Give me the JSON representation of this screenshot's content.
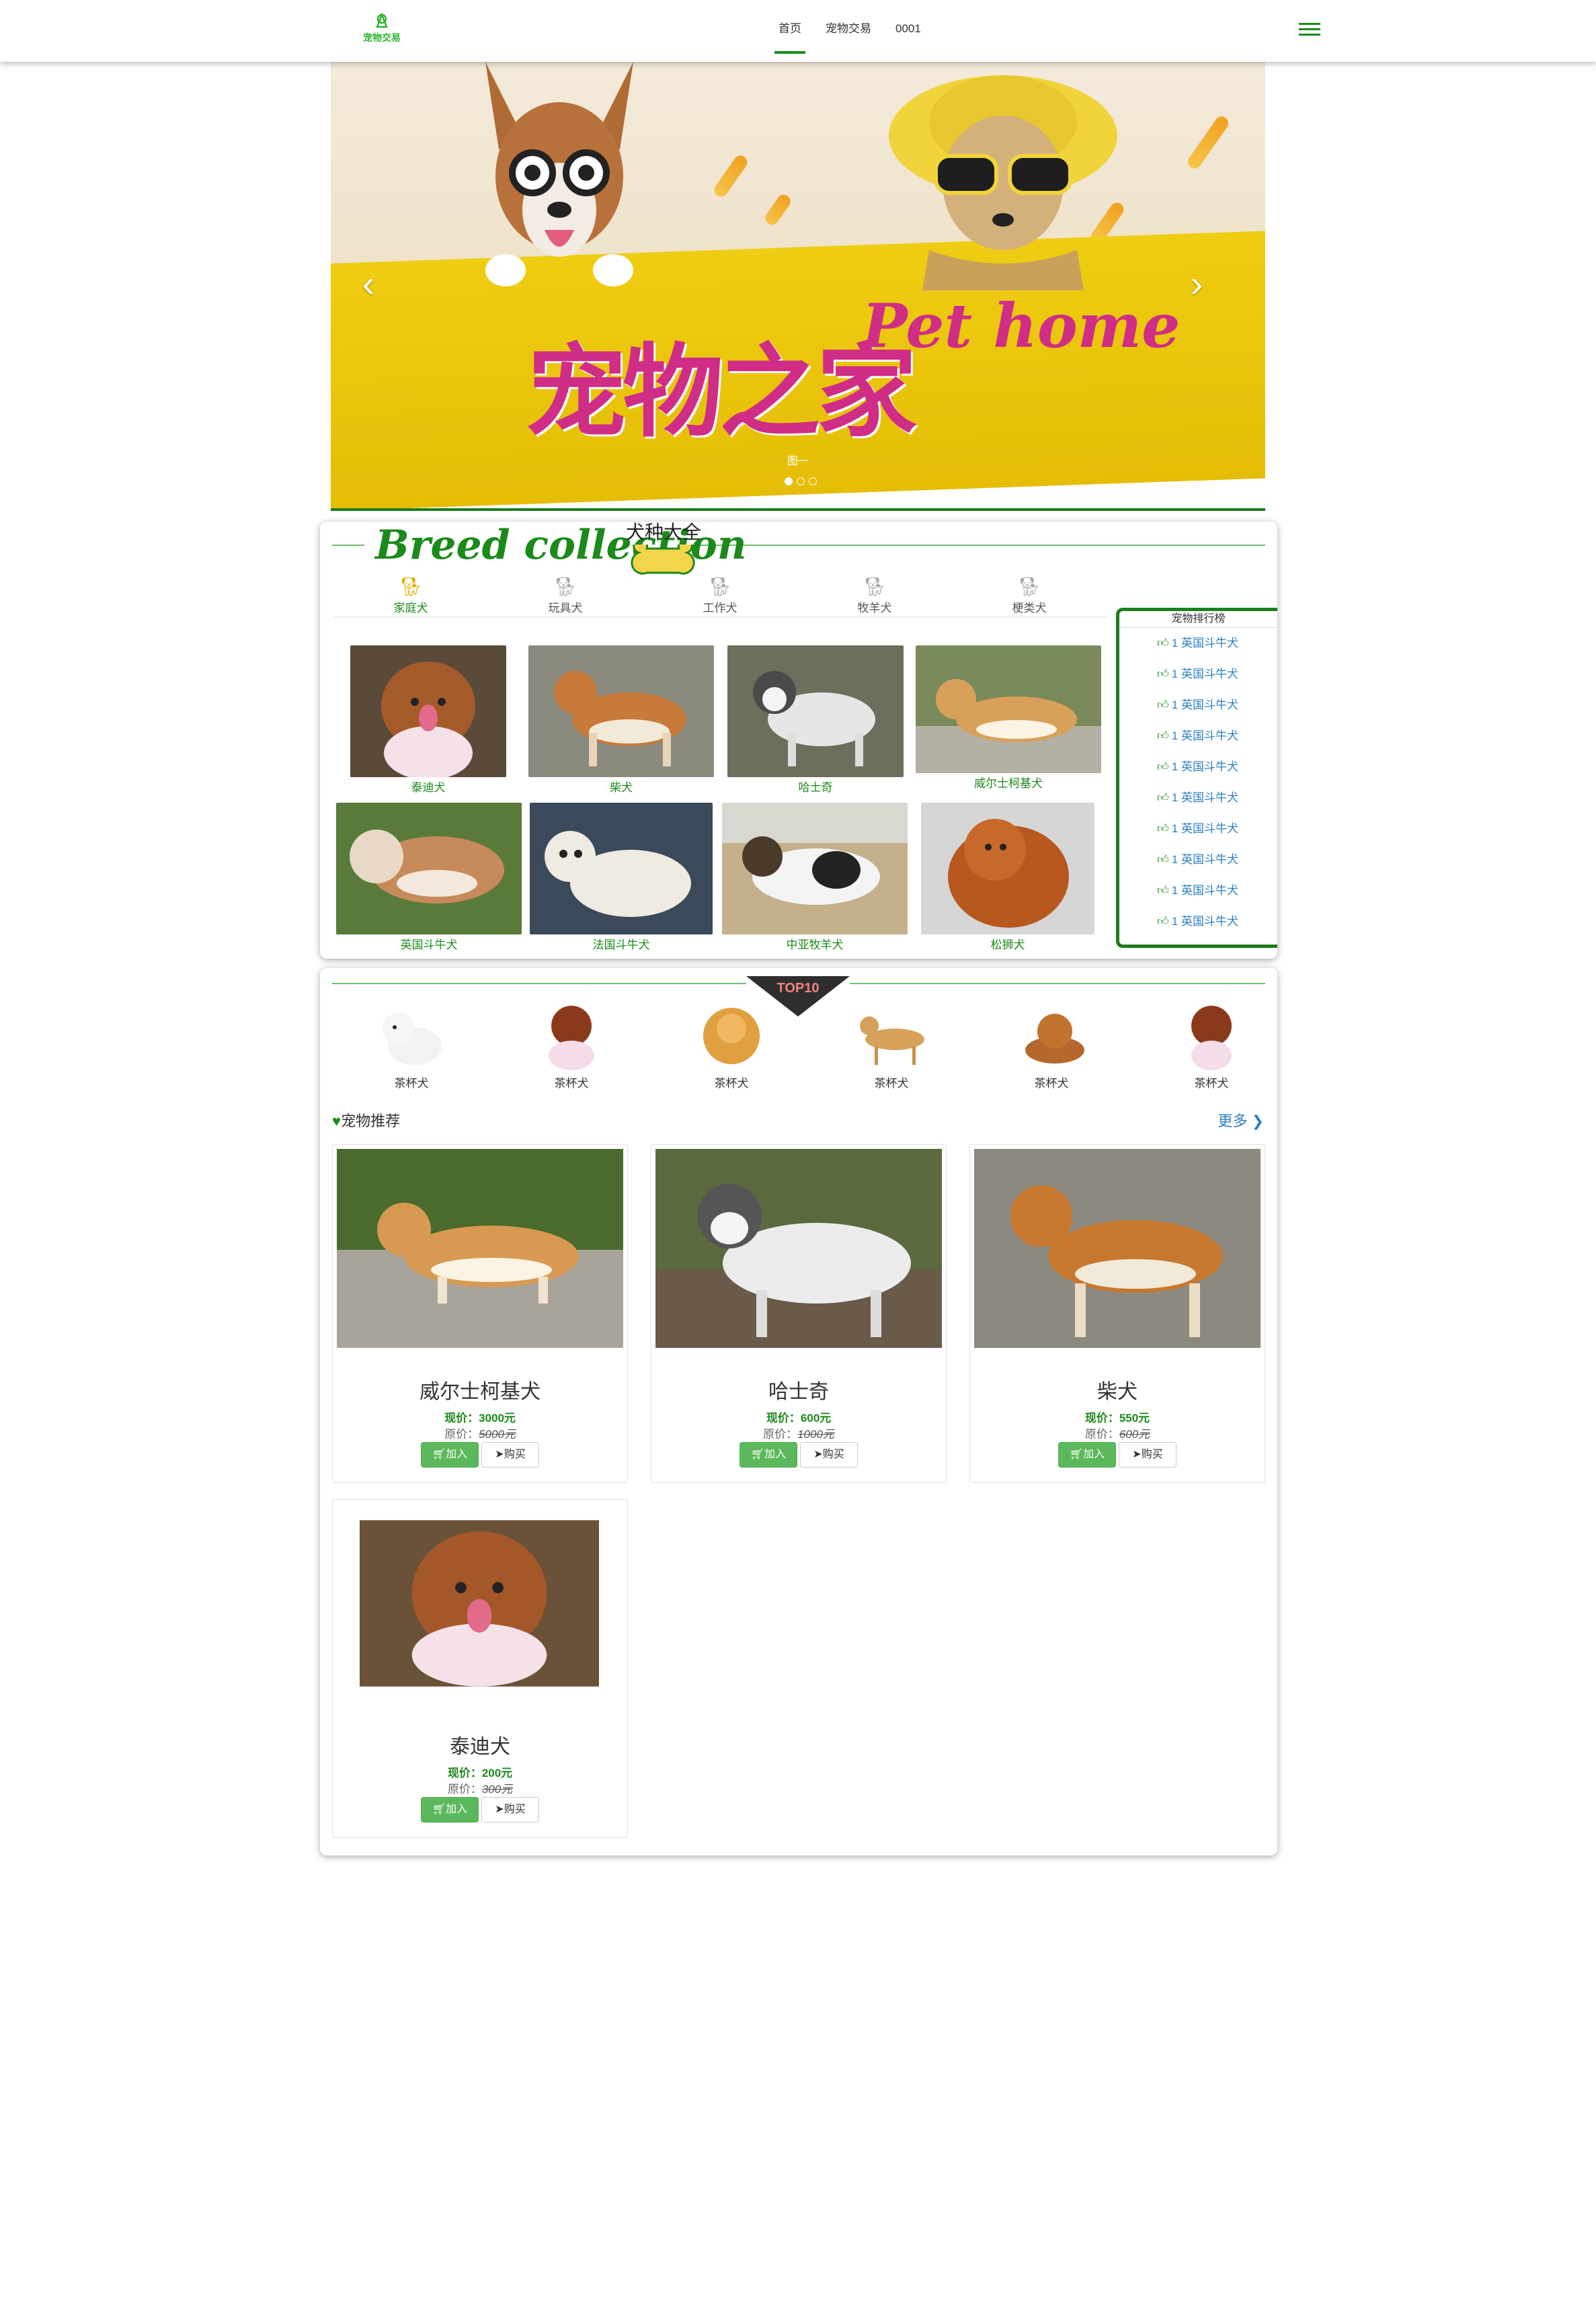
{
  "header": {
    "logo_text": "宠物交易",
    "nav": [
      "首页",
      "宠物交易",
      "0001"
    ],
    "active_index": 0
  },
  "banner": {
    "title_cn": "宠物之家",
    "title_en": "Pet home",
    "caption": "图一",
    "prev": "‹",
    "next": "›",
    "slide_count": 3,
    "active_slide": 0
  },
  "breeds": {
    "title": "Breed collection",
    "subtitle": "犬种大全",
    "tabs": [
      "家庭犬",
      "玩具犬",
      "工作犬",
      "牧羊犬",
      "梗类犬"
    ],
    "active_tab": 0,
    "dogs": [
      "泰迪犬",
      "柴犬",
      "哈士奇",
      "威尔士柯基犬",
      "英国斗牛犬",
      "法国斗牛犬",
      "中亚牧羊犬",
      "松狮犬"
    ]
  },
  "ranking": {
    "title": "宠物排行榜",
    "items": [
      "1 英国斗牛犬",
      "1 英国斗牛犬",
      "1 英国斗牛犬",
      "1 英国斗牛犬",
      "1 英国斗牛犬",
      "1 英国斗牛犬",
      "1 英国斗牛犬",
      "1 英国斗牛犬",
      "1 英国斗牛犬",
      "1 英国斗牛犬"
    ]
  },
  "top10": {
    "badge": "TOP10",
    "items": [
      "茶杯犬",
      "茶杯犬",
      "茶杯犬",
      "茶杯犬",
      "茶杯犬",
      "茶杯犬"
    ]
  },
  "recommend": {
    "title": "宠物推荐",
    "more": "更多",
    "add_label": "加入",
    "buy_label": "购买",
    "now_prefix": "现价：",
    "old_prefix": "原价：",
    "products": [
      {
        "name": "威尔士柯基犬",
        "now": "3000元",
        "old": "5000元"
      },
      {
        "name": "哈士奇",
        "now": "600元",
        "old": "1000元"
      },
      {
        "name": "柴犬",
        "now": "550元",
        "old": "600元"
      },
      {
        "name": "泰迪犬",
        "now": "200元",
        "old": "300元"
      }
    ]
  },
  "colors": {
    "brand_green": "#1b8a1b",
    "banner_yellow": "#e9c30a",
    "pink": "#d02d86",
    "link_blue": "#2b7fc2"
  }
}
